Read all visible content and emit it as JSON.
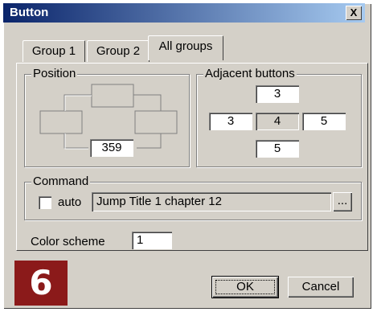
{
  "window": {
    "title": "Button",
    "close_label": "X"
  },
  "tabs": [
    {
      "label": "Group 1"
    },
    {
      "label": "Group 2"
    },
    {
      "label": "All groups"
    }
  ],
  "position": {
    "label": "Position",
    "value": "359"
  },
  "adjacent": {
    "label": "Adjacent buttons",
    "top": "3",
    "left": "3",
    "center": "4",
    "right": "5",
    "bottom": "5"
  },
  "command": {
    "label": "Command",
    "auto_label": "auto",
    "auto_checked": false,
    "value": "Jump Title 1 chapter 12",
    "browse_label": "..."
  },
  "color_scheme": {
    "label": "Color scheme",
    "value": "1"
  },
  "buttons": {
    "ok": "OK",
    "cancel": "Cancel"
  },
  "badge": {
    "text": "6",
    "color": "#8b1a1a"
  },
  "colors": {
    "titlebar_start": "#0a246a",
    "titlebar_end": "#a6caf0",
    "face": "#d4d0c8"
  }
}
